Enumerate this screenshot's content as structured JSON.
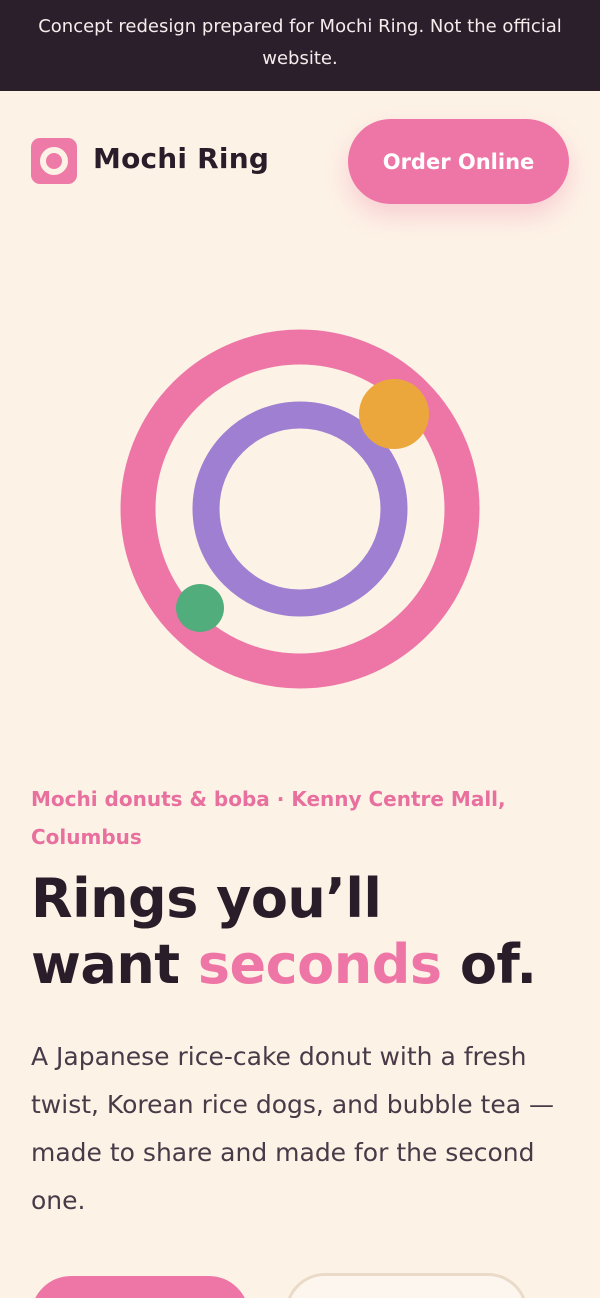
{
  "banner": {
    "text": "Concept redesign prepared for Mochi Ring. Not the official website."
  },
  "header": {
    "brand_name": "Mochi Ring",
    "order_label": "Order Online"
  },
  "hero": {
    "eyebrow": "Mochi donuts & boba · Kenny Centre Mall, Columbus",
    "headline_part1": "Rings you’ll",
    "headline_part2": "want ",
    "headline_accent": "seconds",
    "headline_part3": " of.",
    "lede": "A Japanese rice-cake donut with a fresh twist, Korean rice dogs, and bubble tea — made to share and made for the second one."
  },
  "colors": {
    "banner_bg": "#2b1f2b",
    "page_bg": "#fdf2e6",
    "brand_pink": "#ee76a6",
    "ring_purple": "#9f7fd1",
    "dot_orange": "#eba73b",
    "dot_green": "#51ad7b",
    "text_dark": "#2a1d2a"
  },
  "icons": {
    "logo": "ring-logo-icon",
    "hero_art": "rings-illustration"
  }
}
